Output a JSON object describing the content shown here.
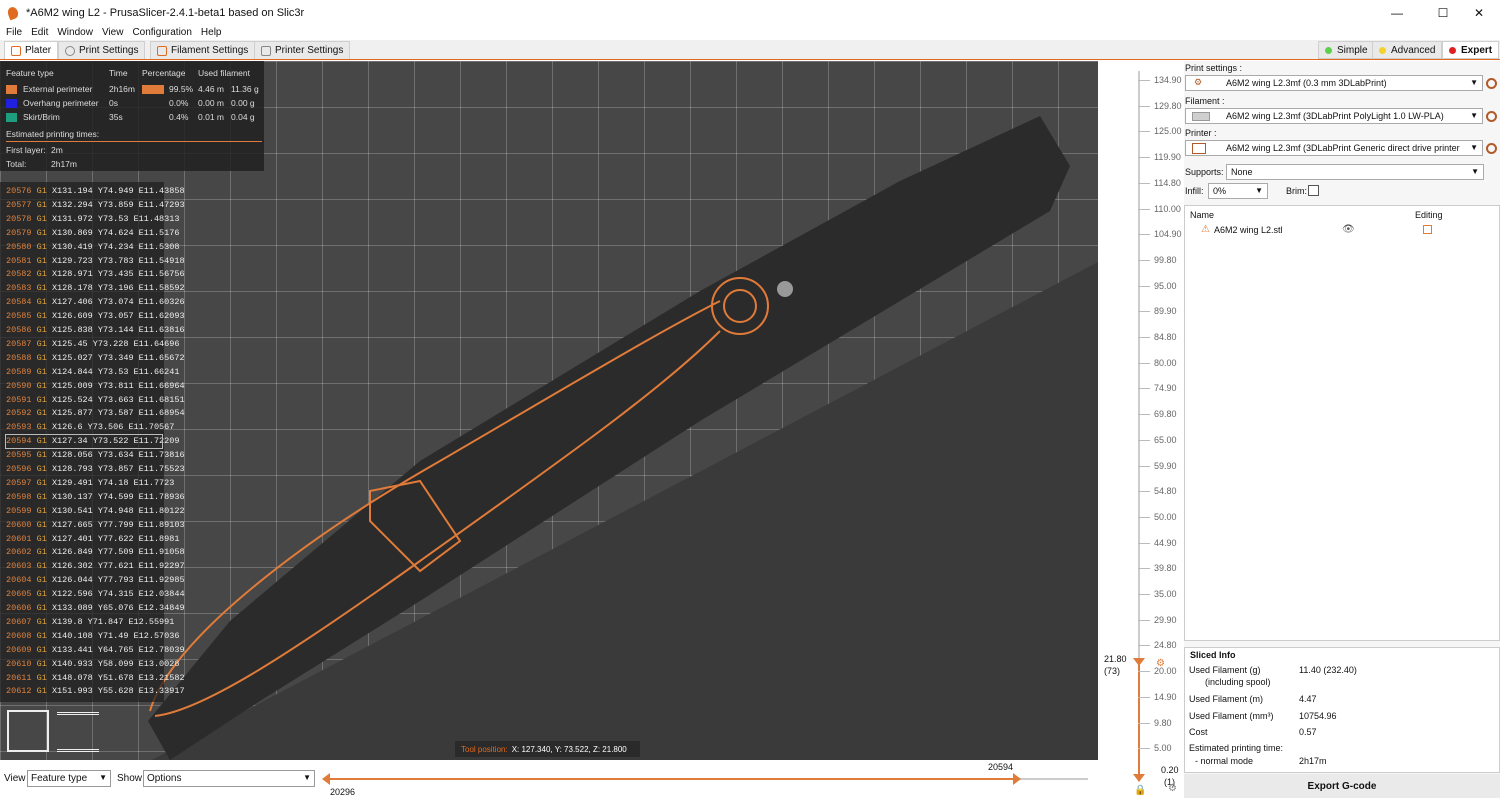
{
  "window": {
    "title": "*A6M2 wing L2 - PrusaSlicer-2.4.1-beta1 based on Slic3r",
    "minimize": "—",
    "maximize": "☐",
    "close": "✕"
  },
  "menu": [
    "File",
    "Edit",
    "Window",
    "View",
    "Configuration",
    "Help"
  ],
  "tabs": [
    {
      "label": "Plater"
    },
    {
      "label": "Print Settings"
    },
    {
      "label": "Filament Settings"
    },
    {
      "label": "Printer Settings"
    }
  ],
  "modes": [
    {
      "label": "Simple",
      "color": "#5fcf4f"
    },
    {
      "label": "Advanced",
      "color": "#f3d22b"
    },
    {
      "label": "Expert",
      "color": "#e02020"
    }
  ],
  "legend": {
    "headers": [
      "Feature type",
      "Time",
      "Percentage",
      "Used filament"
    ],
    "rows": [
      {
        "name": "External perimeter",
        "color": "#e07b39",
        "time": "2h16m",
        "pct": "99.5%",
        "len": "4.46 m",
        "weight": "11.36 g"
      },
      {
        "name": "Overhang perimeter",
        "color": "#2020e0",
        "time": "0s",
        "pct": "0.0%",
        "len": "0.00 m",
        "weight": "0.00 g"
      },
      {
        "name": "Skirt/Brim",
        "color": "#1e9e7e",
        "time": "35s",
        "pct": "0.4%",
        "len": "0.01 m",
        "weight": "0.04 g"
      }
    ],
    "estimated_label": "Estimated printing times:",
    "first_layer_label": "First layer:",
    "first_layer": "2m",
    "total_label": "Total:",
    "total": "2h17m"
  },
  "gcode": [
    {
      "n": "20576",
      "c": "G1",
      "a": "X131.194 Y74.949 E11.43858"
    },
    {
      "n": "20577",
      "c": "G1",
      "a": "X132.294 Y73.859 E11.47293"
    },
    {
      "n": "20578",
      "c": "G1",
      "a": "X131.972 Y73.53 E11.48313"
    },
    {
      "n": "20579",
      "c": "G1",
      "a": "X130.869 Y74.624 E11.5176"
    },
    {
      "n": "20580",
      "c": "G1",
      "a": "X130.419 Y74.234 E11.5308"
    },
    {
      "n": "20581",
      "c": "G1",
      "a": "X129.723 Y73.783 E11.54918"
    },
    {
      "n": "20582",
      "c": "G1",
      "a": "X128.971 Y73.435 E11.56756"
    },
    {
      "n": "20583",
      "c": "G1",
      "a": "X128.178 Y73.196 E11.58592"
    },
    {
      "n": "20584",
      "c": "G1",
      "a": "X127.406 Y73.074 E11.60326"
    },
    {
      "n": "20585",
      "c": "G1",
      "a": "X126.609 Y73.057 E11.62093"
    },
    {
      "n": "20586",
      "c": "G1",
      "a": "X125.838 Y73.144 E11.63816"
    },
    {
      "n": "20587",
      "c": "G1",
      "a": "X125.45 Y73.228 E11.64696"
    },
    {
      "n": "20588",
      "c": "G1",
      "a": "X125.027 Y73.349 E11.65672"
    },
    {
      "n": "20589",
      "c": "G1",
      "a": "X124.844 Y73.53 E11.66241"
    },
    {
      "n": "20590",
      "c": "G1",
      "a": "X125.009 Y73.811 E11.66964"
    },
    {
      "n": "20591",
      "c": "G1",
      "a": "X125.524 Y73.663 E11.68151"
    },
    {
      "n": "20592",
      "c": "G1",
      "a": "X125.877 Y73.587 E11.68954"
    },
    {
      "n": "20593",
      "c": "G1",
      "a": "X126.6 Y73.506 E11.70567"
    },
    {
      "n": "20594",
      "c": "G1",
      "a": "X127.34 Y73.522 E11.72209"
    },
    {
      "n": "20595",
      "c": "G1",
      "a": "X128.056 Y73.634 E11.73816"
    },
    {
      "n": "20596",
      "c": "G1",
      "a": "X128.793 Y73.857 E11.75523"
    },
    {
      "n": "20597",
      "c": "G1",
      "a": "X129.491 Y74.18 E11.7723"
    },
    {
      "n": "20598",
      "c": "G1",
      "a": "X130.137 Y74.599 E11.78936"
    },
    {
      "n": "20599",
      "c": "G1",
      "a": "X130.541 Y74.948 E11.80122"
    },
    {
      "n": "20600",
      "c": "G1",
      "a": "X127.665 Y77.799 E11.89103"
    },
    {
      "n": "20601",
      "c": "G1",
      "a": "X127.401 Y77.622 E11.8981"
    },
    {
      "n": "20602",
      "c": "G1",
      "a": "X126.849 Y77.509 E11.91058"
    },
    {
      "n": "20603",
      "c": "G1",
      "a": "X126.302 Y77.621 E11.92297"
    },
    {
      "n": "20604",
      "c": "G1",
      "a": "X126.044 Y77.793 E11.92985"
    },
    {
      "n": "20605",
      "c": "G1",
      "a": "X122.596 Y74.315 E12.03844"
    },
    {
      "n": "20606",
      "c": "G1",
      "a": "X133.089 Y65.076 E12.34849"
    },
    {
      "n": "20607",
      "c": "G1",
      "a": "X139.8 Y71.847 E12.55991"
    },
    {
      "n": "20608",
      "c": "G1",
      "a": "X140.108 Y71.49 E12.57036"
    },
    {
      "n": "20609",
      "c": "G1",
      "a": "X133.441 Y64.765 E12.78039"
    },
    {
      "n": "20610",
      "c": "G1",
      "a": "X140.933 Y58.099 E13.0028"
    },
    {
      "n": "20611",
      "c": "G1",
      "a": "X148.078 Y51.678 E13.21582"
    },
    {
      "n": "20612",
      "c": "G1",
      "a": "X151.993 Y55.628 E13.33917"
    }
  ],
  "tool_position": {
    "label": "Tool position:",
    "value": "X: 127.340, Y: 73.522, Z: 21.800"
  },
  "layer_slider": {
    "ticks": [
      "134.90",
      "129.80",
      "125.00",
      "119.90",
      "114.80",
      "110.00",
      "104.90",
      "99.80",
      "95.00",
      "89.90",
      "84.80",
      "80.00",
      "74.90",
      "69.80",
      "65.00",
      "59.90",
      "54.80",
      "50.00",
      "44.90",
      "39.80",
      "35.00",
      "29.90",
      "24.80",
      "20.00",
      "14.90",
      "9.80",
      "5.00"
    ],
    "upper_value": "21.80",
    "upper_layer": "(73)",
    "lower_value": "0.20",
    "lower_layer": "(1)"
  },
  "sidebar": {
    "print_settings_label": "Print settings :",
    "print_settings": "A6M2 wing L2.3mf (0.3 mm 3DLabPrint)",
    "filament_label": "Filament :",
    "filament": "A6M2 wing L2.3mf (3DLabPrint PolyLight 1.0 LW-PLA)",
    "printer_label": "Printer :",
    "printer": "A6M2 wing L2.3mf (3DLabPrint Generic direct drive printer",
    "supports_label": "Supports:",
    "supports": "None",
    "infill_label": "Infill:",
    "infill": "0%",
    "brim_label": "Brim:",
    "object_list": {
      "name_header": "Name",
      "editing_header": "Editing",
      "objects": [
        {
          "name": "A6M2 wing L2.stl"
        }
      ]
    }
  },
  "sliced_info": {
    "title": "Sliced Info",
    "rows": [
      {
        "label": "Used Filament (g)",
        "value": "11.40 (232.40)"
      },
      {
        "label": "(including spool)",
        "value": ""
      },
      {
        "label": "Used Filament (m)",
        "value": "4.47"
      },
      {
        "label": "Used Filament (mm³)",
        "value": "10754.96"
      },
      {
        "label": "Cost",
        "value": "0.57"
      },
      {
        "label": "Estimated printing time:",
        "value": ""
      },
      {
        "label": "- normal mode",
        "value": "2h17m"
      }
    ],
    "export_label": "Export G-code"
  },
  "bottom": {
    "view_label": "View",
    "view_value": "Feature type",
    "show_label": "Show",
    "show_value": "Options",
    "move_start": "20296",
    "move_end": "20594"
  },
  "colors": {
    "accent": "#e06b1f",
    "viewport": "#474747",
    "model": "#2b2b2b"
  }
}
